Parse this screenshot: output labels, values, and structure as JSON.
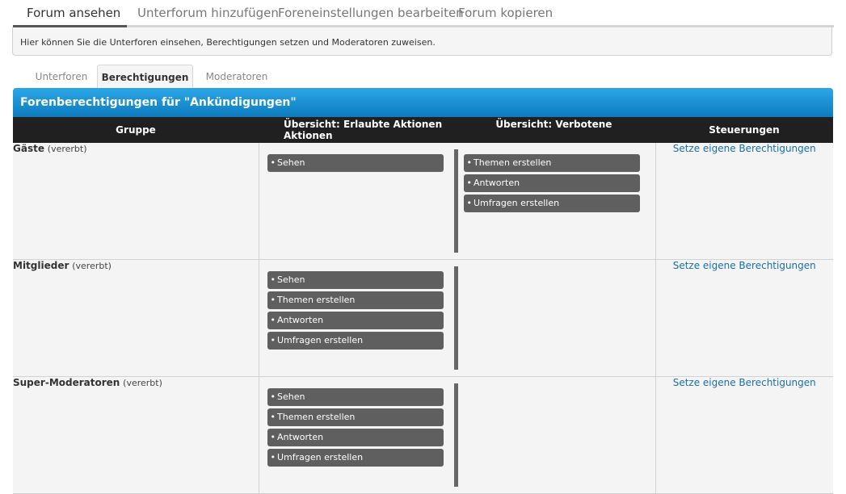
{
  "nav": {
    "tabs": [
      {
        "label": "Forum ansehen"
      },
      {
        "label": "Unterforum hinzufügen"
      },
      {
        "label": "Foreneinstellungen bearbeiten"
      },
      {
        "label": "Forum kopieren"
      }
    ]
  },
  "info": "Hier können Sie die Unterforen einsehen, Berechtigungen setzen und Moderatoren zuweisen.",
  "subtabs": [
    {
      "label": "Unterforen"
    },
    {
      "label": "Berechtigungen"
    },
    {
      "label": "Moderatoren"
    }
  ],
  "panel": {
    "title": "Forenberechtigungen für \"Ankündigungen\"",
    "headers": [
      "Gruppe",
      "Übersicht: Erlaubte Aktionen",
      "Übersicht: Verbotene Aktionen",
      "Steuerungen"
    ],
    "rows": [
      {
        "group": "Gäste",
        "inherited": "(vererbt)",
        "allowed": [
          "Sehen"
        ],
        "denied": [
          "Themen erstellen",
          "Antworten",
          "Umfragen erstellen"
        ],
        "control": "Setze eigene Berechtigungen"
      },
      {
        "group": "Mitglieder",
        "inherited": "(vererbt)",
        "allowed": [
          "Sehen",
          "Themen erstellen",
          "Antworten",
          "Umfragen erstellen"
        ],
        "denied": [],
        "control": "Setze eigene Berechtigungen"
      },
      {
        "group": "Super-Moderatoren",
        "inherited": "(vererbt)",
        "allowed": [
          "Sehen",
          "Themen erstellen",
          "Antworten",
          "Umfragen erstellen"
        ],
        "denied": [],
        "control": "Setze eigene Berechtigungen"
      }
    ]
  },
  "colors": {
    "header_blue": "#1a8fd4",
    "column_header": "#202020",
    "pill": "#5f5f5f",
    "link": "#1a6faa"
  }
}
